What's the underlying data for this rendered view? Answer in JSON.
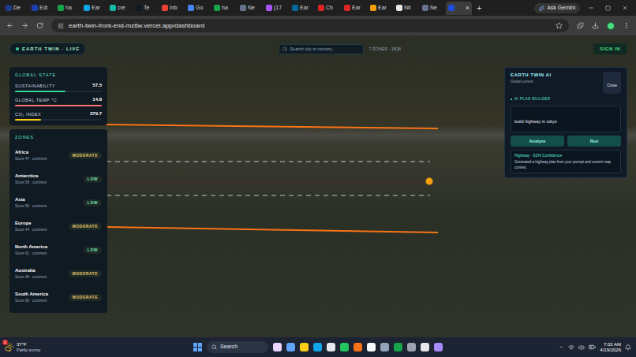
{
  "browser": {
    "tabs": [
      {
        "label": "De",
        "selected": false
      },
      {
        "label": "Edi",
        "selected": false
      },
      {
        "label": "ha",
        "selected": false
      },
      {
        "label": "Ear",
        "selected": false
      },
      {
        "label": "cre",
        "selected": false
      },
      {
        "label": "Te",
        "selected": false
      },
      {
        "label": "Inb",
        "selected": false
      },
      {
        "label": "Go",
        "selected": false
      },
      {
        "label": "ha",
        "selected": false
      },
      {
        "label": "Ne",
        "selected": false
      },
      {
        "label": "(17",
        "selected": false
      },
      {
        "label": "Ear",
        "selected": false
      },
      {
        "label": "Ch",
        "selected": false
      },
      {
        "label": "Ear",
        "selected": false
      },
      {
        "label": "Ear",
        "selected": false
      },
      {
        "label": "Nit",
        "selected": false
      },
      {
        "label": "Ne",
        "selected": false
      },
      {
        "label": "",
        "selected": true
      }
    ],
    "tab_close": "×",
    "new_tab": "+",
    "ask_gemini": "Ask Gemini",
    "url": "earth-twin-front-end-mz6w.vercel.app/dashboard"
  },
  "app": {
    "brand": "EARTH TWIN · LIVE",
    "search": {
      "placeholder": "Search city or country..."
    },
    "zones_count": "7 ZONES · 1826",
    "sign_in": "SIGN IN",
    "global_state": {
      "title": "GLOBAL STATE",
      "metrics": [
        {
          "label": "SUSTAINABILITY",
          "value": "57.5",
          "level": 0.58,
          "color": "#34d399"
        },
        {
          "label": "GLOBAL TEMP °C",
          "value": "14.8",
          "level": 1.0,
          "color": "#f87171"
        },
        {
          "label": "CO₂ INDEX",
          "value": "379.7",
          "level": 0.3,
          "color": "#facc15"
        }
      ]
    },
    "zones": {
      "title": "ZONES",
      "items": [
        {
          "name": "Africa",
          "score": "Score 47 · continent",
          "risk": "MODERATE",
          "color": "#e5c76b"
        },
        {
          "name": "Antarctica",
          "score": "Score 58 · continent",
          "risk": "LOW",
          "color": "#6ee7b7"
        },
        {
          "name": "Asia",
          "score": "Score 58 · continent",
          "risk": "LOW",
          "color": "#6ee7b7"
        },
        {
          "name": "Europe",
          "score": "Score 44 · continent",
          "risk": "MODERATE",
          "color": "#e5c76b"
        },
        {
          "name": "North America",
          "score": "Score 61 · continent",
          "risk": "LOW",
          "color": "#6ee7b7"
        },
        {
          "name": "Australia",
          "score": "Score 48 · continent",
          "risk": "MODERATE",
          "color": "#e5c76b"
        },
        {
          "name": "South America",
          "score": "Score 65 · continent",
          "risk": "MODERATE",
          "color": "#e5c76b"
        }
      ]
    },
    "ai_panel": {
      "title": "EARTH TWIN AI",
      "subtitle": "Global context",
      "close": "Close",
      "section": "AI PLAN BUILDER",
      "prompt": "build highway in tokyo",
      "buttons": [
        "Analyze",
        "Run"
      ],
      "result": {
        "title": "Highway · 62% Confidence",
        "text": "Generated a highway plan from your prompt and current map context."
      }
    }
  },
  "taskbar": {
    "weather": {
      "badge": "2",
      "temp": "37°F",
      "condition": "Partly sunny"
    },
    "search": "Search",
    "time": "7:02 AM",
    "date": "4/19/2026"
  }
}
